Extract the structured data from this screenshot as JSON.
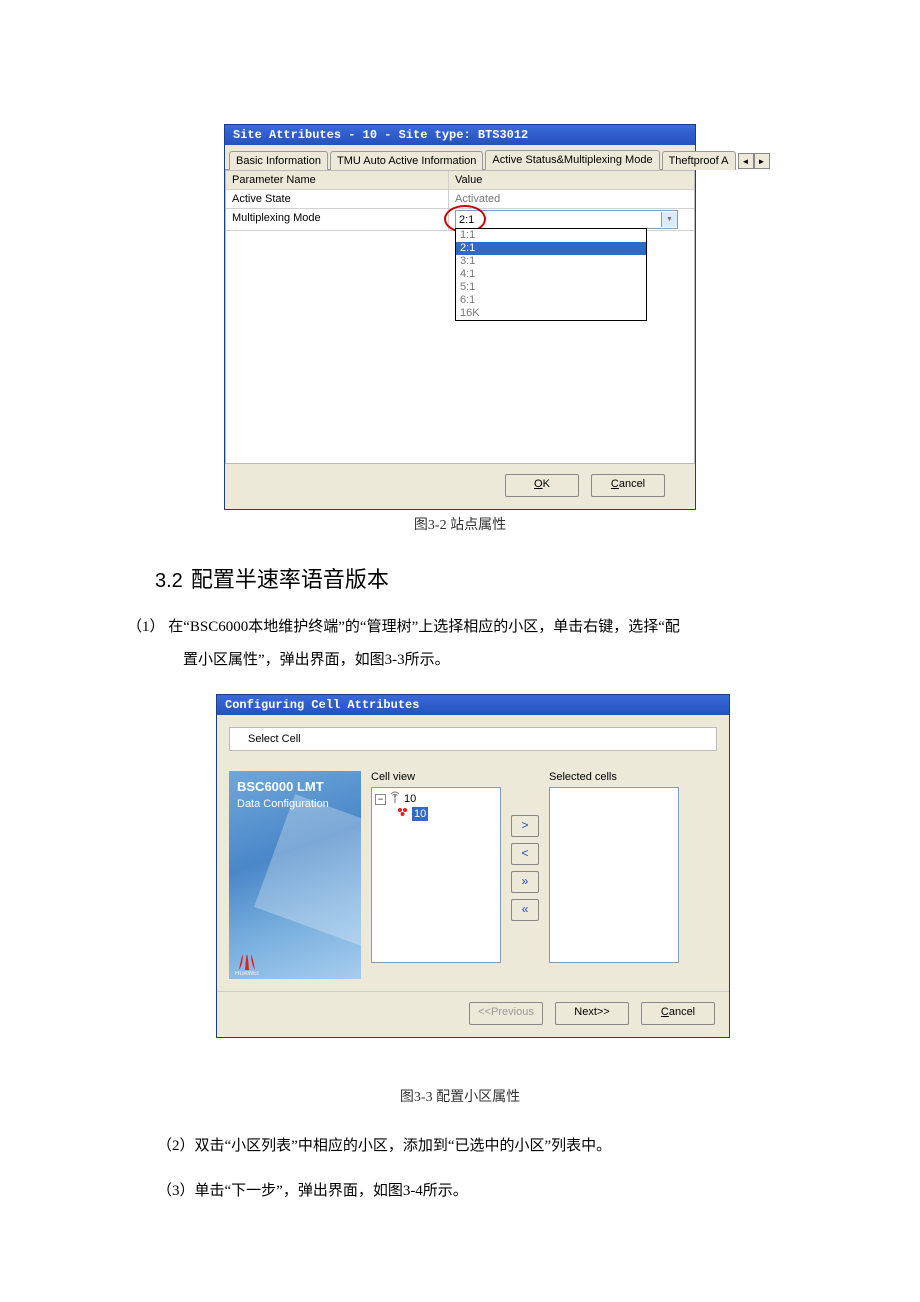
{
  "dlg1": {
    "title": "Site Attributes - 10 - Site type: BTS3012",
    "tabs": [
      "Basic Information",
      "TMU Auto Active Information",
      "Active Status&Multiplexing Mode",
      "Theftproof A"
    ],
    "active_tab_index": 2,
    "header": {
      "param": "Parameter Name",
      "value": "Value"
    },
    "rows": [
      {
        "param": "Active State",
        "value": "Activated"
      },
      {
        "param": "Multiplexing Mode",
        "value": "2:1"
      }
    ],
    "dropdown_options": [
      "1:1",
      "2:1",
      "3:1",
      "4:1",
      "5:1",
      "6:1",
      "16K"
    ],
    "dropdown_selected_index": 1,
    "buttons": {
      "ok": "OK",
      "cancel": "Cancel"
    }
  },
  "captions": {
    "fig32": "图3-2  站点属性",
    "fig33": "图3-3  配置小区属性"
  },
  "section": {
    "heading_num": "3.2",
    "heading_text": "配置半速率语音版本",
    "para1a": "（1）   在“BSC6000本地维护终端”的“管理树”上选择相应的小区，单击右键，选择“配",
    "para1b": "置小区属性”，弹出界面，如图3-3所示。",
    "para2": "（2）双击“小区列表”中相应的小区，添加到“已选中的小区”列表中。",
    "para3": "（3）单击“下一步”，弹出界面，如图3-4所示。"
  },
  "dlg2": {
    "title": "Configuring Cell  Attributes",
    "select_cell_label": "Select Cell",
    "side": {
      "line1": "BSC6000 LMT",
      "line2": "Data Configuration",
      "brand": "HUAWEI"
    },
    "cell_view_label": "Cell view",
    "selected_cells_label": "Selected cells",
    "tree": {
      "root": "10",
      "child": "10"
    },
    "xfer": {
      "add": ">",
      "remove": "<",
      "addall": "»",
      "removeall": "«"
    },
    "buttons": {
      "prev": "<<Previous",
      "next": "Next>>",
      "cancel": "Cancel"
    }
  }
}
